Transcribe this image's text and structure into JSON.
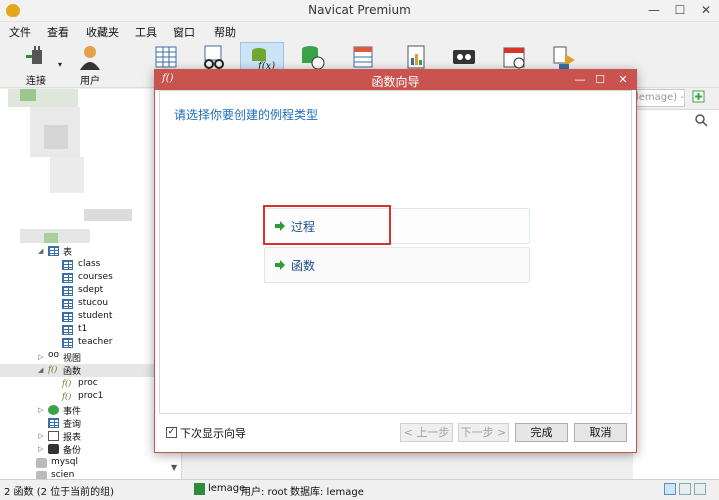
{
  "app": {
    "title": "Navicat Premium",
    "window_controls": [
      "—",
      "☐",
      "✕"
    ]
  },
  "menu": [
    "文件",
    "查看",
    "收藏夹",
    "工具",
    "窗口",
    "帮助"
  ],
  "toolbar": {
    "connect_label": "连接",
    "user_label": "用户"
  },
  "sidebar": {
    "tables_label": "表",
    "tables": [
      "class",
      "courses",
      "sdept",
      "stucou",
      "student",
      "t1",
      "teacher"
    ],
    "views_label": "视图",
    "functions_label": "函数",
    "functions": [
      "proc",
      "proc1"
    ],
    "events_label": "事件",
    "queries_label": "查询",
    "reports_label": "报表",
    "backups_label": "备份",
    "other_db": "mysql",
    "other_db2": "scien"
  },
  "right_pane": {
    "search_text": "lemage) - 表"
  },
  "statusbar": {
    "selection": "2 函数 (2 位于当前的组)",
    "connection": "lemage",
    "user": "用户: root",
    "database": "数据库: lemage"
  },
  "dialog": {
    "fx_symbol": "f()",
    "title": "函数向导",
    "controls": [
      "—",
      "☐",
      "✕"
    ],
    "heading": "请选择你要创建的例程类型",
    "options": [
      "过程",
      "函数"
    ],
    "show_next_time_label": "下次显示向导",
    "show_next_time_checked": "✓",
    "buttons": {
      "prev": "< 上一步",
      "next": "下一步 >",
      "finish": "完成",
      "cancel": "取消"
    }
  },
  "colors": {
    "dialog_accent": "#c9534f",
    "heading_blue": "#1d6fb8",
    "highlight_red": "#d8322c"
  }
}
